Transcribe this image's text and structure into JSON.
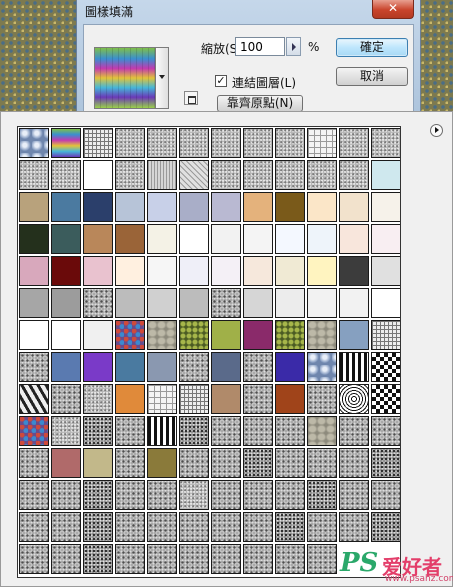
{
  "dialog": {
    "title": "圖樣填滿",
    "close_label": "✕",
    "scale_label": "縮放(S):",
    "scale_value": "100",
    "scale_unit": "%",
    "link_with_layer_checked": true,
    "link_with_layer_label": "連結圖層(L)",
    "snap_to_origin_label": "靠齊原點(N)",
    "ok_label": "確定",
    "cancel_label": "取消",
    "checkbox_glyph": "✓"
  },
  "picker": {
    "menu_icon": "flyout-menu-arrow-icon",
    "rows": 14,
    "cols": 12,
    "swatch_count": 166,
    "swatches": [
      "bubbles",
      "rainbow",
      "grid",
      "noise",
      "noise",
      "noise",
      "noise",
      "noise",
      "noise",
      "fine-grid",
      "noise",
      "noise",
      "noise",
      "noise",
      "#ffffff",
      "noise",
      "lines",
      "diag",
      "noise",
      "noise",
      "noise",
      "noise",
      "noise",
      "#cfe8ee",
      "#b8a27c",
      "#4b7aa0",
      "#2b3f6b",
      "#b7c4d8",
      "#c8d0e8",
      "#a9aec8",
      "#b9b9d2",
      "#e4b27c",
      "#7a5a1a",
      "#fbe6c8",
      "#f2e2cc",
      "#f6f2ea",
      "#24301c",
      "#3b5c5c",
      "#b9875a",
      "#9a6438",
      "#f4f2e6",
      "#ffffff",
      "#f2f2f2",
      "#f4f4f4",
      "#f4f8ff",
      "#eef4fa",
      "#f8e6dc",
      "#f8eef2",
      "#d8a8bc",
      "#6a0a0a",
      "#e9c2cf",
      "#fff0e0",
      "#f6f6f6",
      "#efeff8",
      "#f4f0f6",
      "#f6e8dc",
      "#f0ead4",
      "#fff4c0",
      "#3c3c3c",
      "#e0e0e0",
      "#a6a6a6",
      "#9c9c9c",
      "noise2",
      "#bcbcbc",
      "#d0d0d0",
      "#bcbcbc",
      "noise2",
      "#d6d6d6",
      "#ececec",
      "#f2f2f2",
      "#f2f2f2",
      "#ffffff",
      "#ffffff",
      "#ffffff",
      "#f0f0f0",
      "mosaic",
      "stone",
      "foliage",
      "#a0b048",
      "#8a2a6a",
      "foliage",
      "stone",
      "#86a0c0",
      "grid",
      "noise2",
      "#5a7ab0",
      "#7a3ac8",
      "#4a7aa0",
      "#8a98b0",
      "noise2",
      "#5a6a8a",
      "noise2",
      "#3a2aa8",
      "bubbles",
      "bars",
      "checker",
      "zebra",
      "noise2",
      "noise",
      "#e08a3a",
      "fine-grid",
      "grid",
      "#b08a6a",
      "noise2",
      "#a0441a",
      "noise2",
      "concentric",
      "checker",
      "mosaic",
      "noise",
      "dark-noise",
      "noise2",
      "bars",
      "dark-noise",
      "noise2",
      "noise2",
      "noise2",
      "stone",
      "noise2",
      "noise2",
      "noise2",
      "#b06a6a",
      "#c2b88a",
      "noise2",
      "#8a7a3a",
      "noise2",
      "noise2",
      "dark-noise",
      "noise2",
      "noise2",
      "noise2",
      "dark-noise",
      "noise2",
      "noise2",
      "dark-noise",
      "noise2",
      "noise2",
      "noise",
      "noise2",
      "noise2",
      "noise2",
      "dark-noise",
      "noise2",
      "noise2",
      "noise2",
      "noise2",
      "dark-noise",
      "noise2",
      "noise2",
      "noise2",
      "noise2",
      "noise2",
      "dark-noise",
      "noise2",
      "noise2",
      "dark-noise",
      "noise2",
      "noise2",
      "dark-noise",
      "noise2",
      "noise2",
      "noise2",
      "noise2",
      "noise2",
      "noise2",
      "noise2"
    ]
  },
  "watermark": {
    "ps": "PS",
    "cn": "爱好者",
    "url": "www.psahz.com"
  }
}
